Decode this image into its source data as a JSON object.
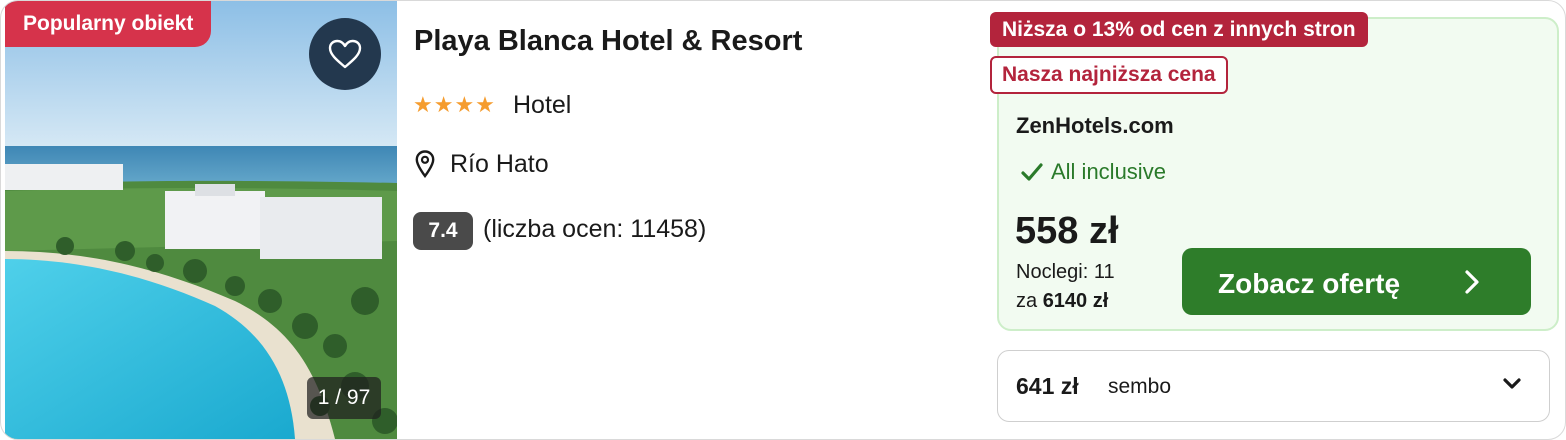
{
  "hotel": {
    "badge": "Popularny obiekt",
    "name": "Playa Blanca Hotel & Resort",
    "stars": "★★★★",
    "star_count": 4,
    "type": "Hotel",
    "location": "Río Hato",
    "score": "7.4",
    "reviews": "(liczba ocen: 11458)",
    "photo_counter": "1 / 97"
  },
  "offer": {
    "tag_lower": "Niższa o 13% od cen z innych stron",
    "tag_lowest": "Nasza najniższa cena",
    "provider": "ZenHotels.com",
    "board": "All inclusive",
    "price": "558 zł",
    "nights": "Noclegi: 11",
    "total_prefix": "za",
    "total": "6140 zł",
    "cta": "Zobacz ofertę"
  },
  "other_offer": {
    "price": "641 zł",
    "source": "sembo"
  },
  "colors": {
    "badge": "#d6334b",
    "tag": "#b3243c",
    "cta": "#2e7d2a",
    "offer_bg": "#f2fbf1",
    "offer_border": "#cdeec9",
    "check": "#2a7a2a",
    "stars": "#f59c2e",
    "fav_bg": "#23384e"
  },
  "icons": {
    "favorite": "heart-icon",
    "location": "map-pin-icon",
    "board": "check-icon",
    "cta": "chevron-right-icon",
    "expand": "chevron-down-icon"
  }
}
